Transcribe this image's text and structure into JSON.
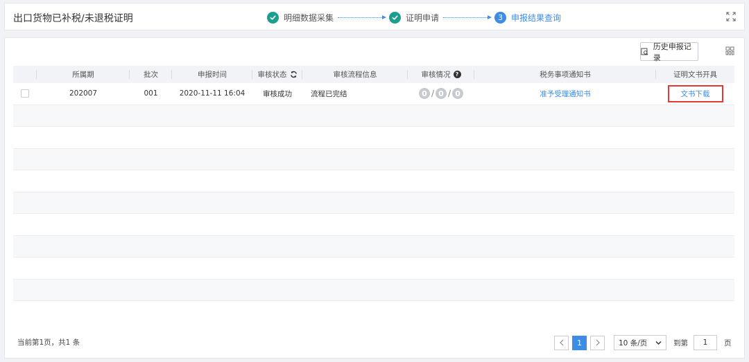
{
  "header": {
    "title": "出口货物已补税/未退税证明",
    "steps": [
      {
        "label": "明细数据采集",
        "state": "done"
      },
      {
        "label": "证明申请",
        "state": "done"
      },
      {
        "label": "申报结果查询",
        "state": "active",
        "number": "3"
      }
    ]
  },
  "toolbar": {
    "history_label": "历史申报记录"
  },
  "table": {
    "columns": [
      "所属期",
      "批次",
      "申报时间",
      "审核状态",
      "审核流程信息",
      "审核情况",
      "税务事项通知书",
      "证明文书开具"
    ],
    "rows": [
      {
        "period": "202007",
        "batch": "001",
        "time": "2020-11-11 16:04",
        "status": "审核成功",
        "flow": "流程已完结",
        "counts": [
          "0",
          "0",
          "0"
        ],
        "notice": "准予受理通知书",
        "doc": "文书下载"
      }
    ]
  },
  "footer": {
    "info": "当前第1页，共1 条",
    "current_page": "1",
    "page_size": "10 条/页",
    "goto_label": "到第",
    "goto_value": "1",
    "page_unit": "页"
  },
  "colors": {
    "accent": "#3d8ce6",
    "done": "#1a9e8f",
    "highlight": "#e53935"
  }
}
